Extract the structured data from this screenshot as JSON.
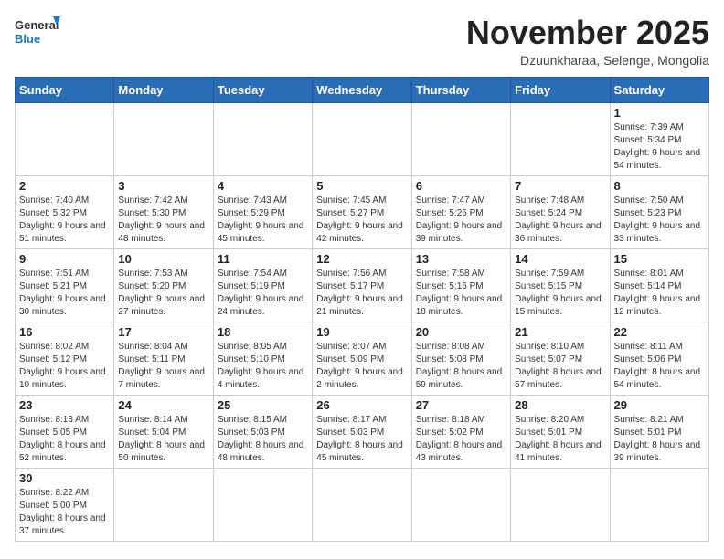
{
  "header": {
    "logo": {
      "general": "General",
      "blue": "Blue"
    },
    "title": "November 2025",
    "location": "Dzuunkharaa, Selenge, Mongolia"
  },
  "weekdays": [
    "Sunday",
    "Monday",
    "Tuesday",
    "Wednesday",
    "Thursday",
    "Friday",
    "Saturday"
  ],
  "weeks": [
    [
      {
        "day": "",
        "info": ""
      },
      {
        "day": "",
        "info": ""
      },
      {
        "day": "",
        "info": ""
      },
      {
        "day": "",
        "info": ""
      },
      {
        "day": "",
        "info": ""
      },
      {
        "day": "",
        "info": ""
      },
      {
        "day": "1",
        "info": "Sunrise: 7:39 AM\nSunset: 5:34 PM\nDaylight: 9 hours and 54 minutes."
      }
    ],
    [
      {
        "day": "2",
        "info": "Sunrise: 7:40 AM\nSunset: 5:32 PM\nDaylight: 9 hours and 51 minutes."
      },
      {
        "day": "3",
        "info": "Sunrise: 7:42 AM\nSunset: 5:30 PM\nDaylight: 9 hours and 48 minutes."
      },
      {
        "day": "4",
        "info": "Sunrise: 7:43 AM\nSunset: 5:29 PM\nDaylight: 9 hours and 45 minutes."
      },
      {
        "day": "5",
        "info": "Sunrise: 7:45 AM\nSunset: 5:27 PM\nDaylight: 9 hours and 42 minutes."
      },
      {
        "day": "6",
        "info": "Sunrise: 7:47 AM\nSunset: 5:26 PM\nDaylight: 9 hours and 39 minutes."
      },
      {
        "day": "7",
        "info": "Sunrise: 7:48 AM\nSunset: 5:24 PM\nDaylight: 9 hours and 36 minutes."
      },
      {
        "day": "8",
        "info": "Sunrise: 7:50 AM\nSunset: 5:23 PM\nDaylight: 9 hours and 33 minutes."
      }
    ],
    [
      {
        "day": "9",
        "info": "Sunrise: 7:51 AM\nSunset: 5:21 PM\nDaylight: 9 hours and 30 minutes."
      },
      {
        "day": "10",
        "info": "Sunrise: 7:53 AM\nSunset: 5:20 PM\nDaylight: 9 hours and 27 minutes."
      },
      {
        "day": "11",
        "info": "Sunrise: 7:54 AM\nSunset: 5:19 PM\nDaylight: 9 hours and 24 minutes."
      },
      {
        "day": "12",
        "info": "Sunrise: 7:56 AM\nSunset: 5:17 PM\nDaylight: 9 hours and 21 minutes."
      },
      {
        "day": "13",
        "info": "Sunrise: 7:58 AM\nSunset: 5:16 PM\nDaylight: 9 hours and 18 minutes."
      },
      {
        "day": "14",
        "info": "Sunrise: 7:59 AM\nSunset: 5:15 PM\nDaylight: 9 hours and 15 minutes."
      },
      {
        "day": "15",
        "info": "Sunrise: 8:01 AM\nSunset: 5:14 PM\nDaylight: 9 hours and 12 minutes."
      }
    ],
    [
      {
        "day": "16",
        "info": "Sunrise: 8:02 AM\nSunset: 5:12 PM\nDaylight: 9 hours and 10 minutes."
      },
      {
        "day": "17",
        "info": "Sunrise: 8:04 AM\nSunset: 5:11 PM\nDaylight: 9 hours and 7 minutes."
      },
      {
        "day": "18",
        "info": "Sunrise: 8:05 AM\nSunset: 5:10 PM\nDaylight: 9 hours and 4 minutes."
      },
      {
        "day": "19",
        "info": "Sunrise: 8:07 AM\nSunset: 5:09 PM\nDaylight: 9 hours and 2 minutes."
      },
      {
        "day": "20",
        "info": "Sunrise: 8:08 AM\nSunset: 5:08 PM\nDaylight: 8 hours and 59 minutes."
      },
      {
        "day": "21",
        "info": "Sunrise: 8:10 AM\nSunset: 5:07 PM\nDaylight: 8 hours and 57 minutes."
      },
      {
        "day": "22",
        "info": "Sunrise: 8:11 AM\nSunset: 5:06 PM\nDaylight: 8 hours and 54 minutes."
      }
    ],
    [
      {
        "day": "23",
        "info": "Sunrise: 8:13 AM\nSunset: 5:05 PM\nDaylight: 8 hours and 52 minutes."
      },
      {
        "day": "24",
        "info": "Sunrise: 8:14 AM\nSunset: 5:04 PM\nDaylight: 8 hours and 50 minutes."
      },
      {
        "day": "25",
        "info": "Sunrise: 8:15 AM\nSunset: 5:03 PM\nDaylight: 8 hours and 48 minutes."
      },
      {
        "day": "26",
        "info": "Sunrise: 8:17 AM\nSunset: 5:03 PM\nDaylight: 8 hours and 45 minutes."
      },
      {
        "day": "27",
        "info": "Sunrise: 8:18 AM\nSunset: 5:02 PM\nDaylight: 8 hours and 43 minutes."
      },
      {
        "day": "28",
        "info": "Sunrise: 8:20 AM\nSunset: 5:01 PM\nDaylight: 8 hours and 41 minutes."
      },
      {
        "day": "29",
        "info": "Sunrise: 8:21 AM\nSunset: 5:01 PM\nDaylight: 8 hours and 39 minutes."
      }
    ],
    [
      {
        "day": "30",
        "info": "Sunrise: 8:22 AM\nSunset: 5:00 PM\nDaylight: 8 hours and 37 minutes."
      },
      {
        "day": "",
        "info": ""
      },
      {
        "day": "",
        "info": ""
      },
      {
        "day": "",
        "info": ""
      },
      {
        "day": "",
        "info": ""
      },
      {
        "day": "",
        "info": ""
      },
      {
        "day": "",
        "info": ""
      }
    ]
  ]
}
